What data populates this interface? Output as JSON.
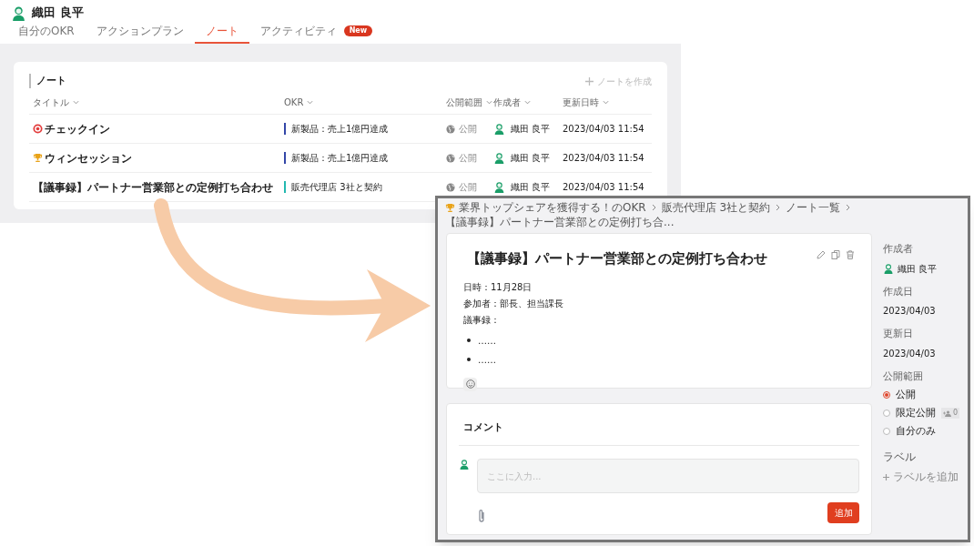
{
  "header": {
    "user_name": "織田 良平",
    "tabs": [
      {
        "label": "自分のOKR",
        "selected": false
      },
      {
        "label": "アクションプラン",
        "selected": false
      },
      {
        "label": "ノート",
        "selected": true
      },
      {
        "label": "アクティビティ",
        "selected": false,
        "badge": "New"
      }
    ]
  },
  "notes": {
    "title": "ノート",
    "create_button": "ノートを作成",
    "columns": [
      "タイトル",
      "OKR",
      "公開範囲",
      "作成者",
      "更新日時"
    ],
    "rows": [
      {
        "title": "チェックイン",
        "okr": "新製品：売上1億円達成",
        "color": "#3346a8",
        "visibility": "公開",
        "author": "織田 良平",
        "updated": "2023/04/03 11:54"
      },
      {
        "title": "ウィンセッション",
        "okr": "新製品：売上1億円達成",
        "color": "#3346a8",
        "visibility": "公開",
        "author": "織田 良平",
        "updated": "2023/04/03 11:54"
      },
      {
        "title": "【議事録】パートナー営業部との定例打ち合わせ",
        "okr": "販売代理店 3社と契約",
        "color": "#22b8b0",
        "visibility": "公開",
        "author": "織田 良平",
        "updated": "2023/04/03 11:54"
      }
    ]
  },
  "detail": {
    "breadcrumb": [
      "業界トップシェアを獲得する！のOKR",
      "販売代理店 3社と契約",
      "ノート一覧",
      "【議事録】パートナー営業部との定例打ち合..."
    ],
    "title": "【議事録】パートナー営業部との定例打ち合わせ",
    "lines": [
      "日時：11月28日",
      "参加者：部長、担当課長",
      "議事録："
    ],
    "bullets": [
      "……",
      "……"
    ],
    "sidebar": {
      "author_label": "作成者",
      "author": "織田 良平",
      "created_label": "作成日",
      "created": "2023/04/03",
      "updated_label": "更新日",
      "updated": "2023/04/03",
      "visibility_label": "公開範囲",
      "options": [
        {
          "label": "公開",
          "selected": true
        },
        {
          "label": "限定公開",
          "selected": false,
          "count": "0"
        },
        {
          "label": "自分のみ",
          "selected": false
        }
      ],
      "label_title": "ラベル",
      "add_label": "ラベルを追加"
    },
    "comment": {
      "title": "コメント",
      "placeholder": "ここに入力...",
      "submit": "追加"
    }
  }
}
